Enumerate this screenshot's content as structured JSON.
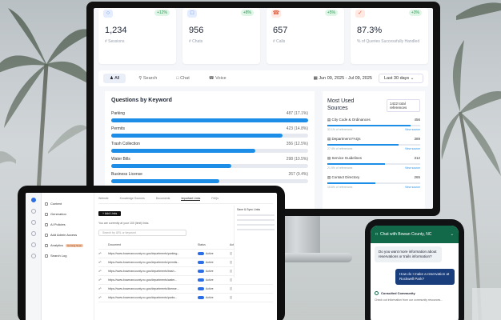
{
  "stats": [
    {
      "value": "1,234",
      "label": "# Sessions",
      "chip": "+12%"
    },
    {
      "value": "956",
      "label": "# Chats",
      "chip": "+8%"
    },
    {
      "value": "657",
      "label": "# Calls",
      "chip": "+5%"
    },
    {
      "value": "87.3%",
      "label": "% of Queries Successfully Handled",
      "chip": "+3%"
    }
  ],
  "filters": {
    "all": "All",
    "search": "Search",
    "chat": "Chat",
    "voice": "Voice",
    "date_range": "Jun 09, 2025 - Jul 09, 2025",
    "period": "Last 30 days"
  },
  "questions": {
    "title": "Questions by Keyword",
    "items": [
      {
        "label": "Parking",
        "count": "487 (17.1%)",
        "fraction": 1.0
      },
      {
        "label": "Permits",
        "count": "423 (14.8%)",
        "fraction": 0.87
      },
      {
        "label": "Trash Collection",
        "count": "356 (12.5%)",
        "fraction": 0.73
      },
      {
        "label": "Water Bills",
        "count": "298 (10.5%)",
        "fraction": 0.61
      },
      {
        "label": "Business License",
        "count": "267 (9.4%)",
        "fraction": 0.55
      }
    ]
  },
  "sources": {
    "title": "Most Used Sources",
    "total": "1422 total references",
    "link": "View source",
    "items": [
      {
        "label": "City Code & Ordinances",
        "count": "456",
        "pct": "32.1% of references",
        "fraction": 0.9
      },
      {
        "label": "Department FAQs",
        "count": "389",
        "pct": "27.4% of references",
        "fraction": 0.77
      },
      {
        "label": "Service Guidelines",
        "count": "312",
        "pct": "21.9% of references",
        "fraction": 0.62
      },
      {
        "label": "Contact Directory",
        "count": "265",
        "pct": "18.6% of references",
        "fraction": 0.52
      }
    ]
  },
  "tablet": {
    "menu": [
      {
        "label": "Content"
      },
      {
        "label": "Generation"
      },
      {
        "label": "AI Policies"
      },
      {
        "label": "Add Admin Access"
      },
      {
        "label": "Analytics",
        "badge": "Coming Soon"
      },
      {
        "label": "Search Log"
      }
    ],
    "tabs": [
      "Website",
      "Knowledge Sources",
      "Documents",
      "Important Links",
      "FAQs"
    ],
    "add_button": "+ Add Links",
    "caption": "You are currently at your 100 (limit) links.",
    "search_placeholder": "Search by URL or keyword",
    "table_headers": [
      "",
      "Document",
      "Status",
      "Actions"
    ],
    "rows": [
      {
        "doc": "https://www.bowmancounty.nc.gov/departments/parking...",
        "status": "Active"
      },
      {
        "doc": "https://www.bowmancounty.nc.gov/departments/permits...",
        "status": "Active"
      },
      {
        "doc": "https://www.bowmancounty.nc.gov/departments/trash...",
        "status": "Active"
      },
      {
        "doc": "https://www.bowmancounty.nc.gov/departments/water...",
        "status": "Active"
      },
      {
        "doc": "https://www.bowmancounty.nc.gov/departments/license...",
        "status": "Active"
      },
      {
        "doc": "https://www.bowmancounty.nc.gov/departments/parks...",
        "status": "Active"
      }
    ],
    "side_title": "Save & Sync Links"
  },
  "phone": {
    "header": "Chat with Bowan County, NC",
    "bot_msg": "Do you want more information about reservations or trails information?",
    "user_msg": "How do I make a reservation at Rockwell Park?",
    "tool_label": "Consulted Community",
    "snippet": "Check out information from our community resources..."
  },
  "colors": {
    "accent": "#1d8ee8",
    "phone_header": "#12694a",
    "user_bubble": "#1a3d7c"
  }
}
